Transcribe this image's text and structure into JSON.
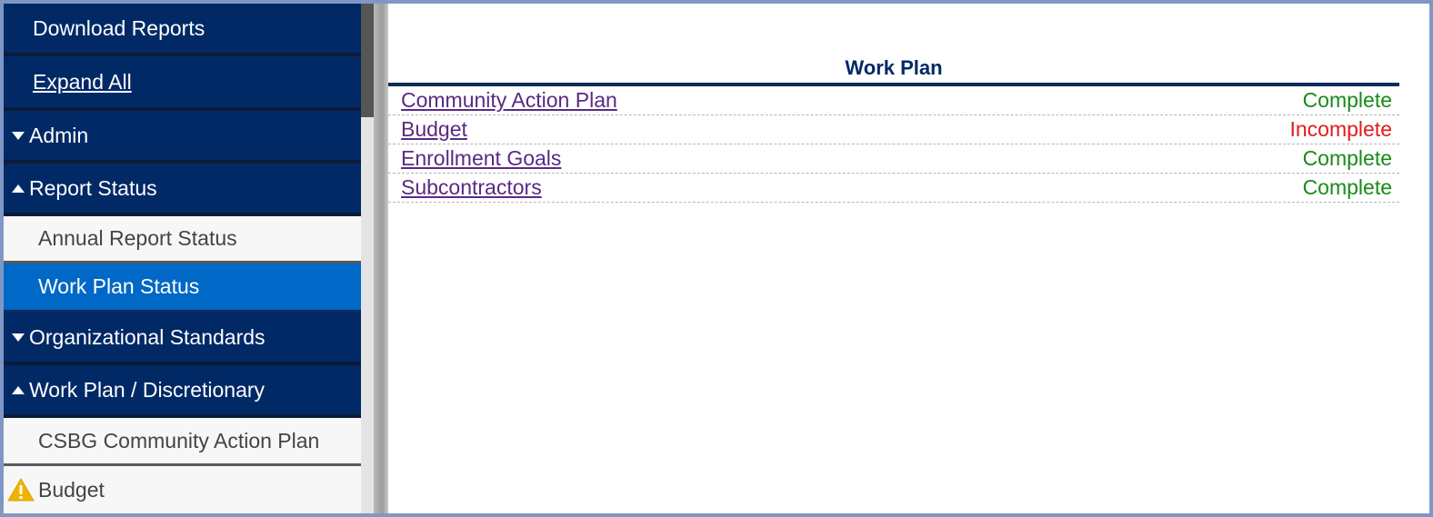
{
  "sidebar": {
    "download_reports": "Download Reports",
    "expand_all": "Expand All",
    "admin": "Admin",
    "report_status": "Report Status",
    "annual_report_status": "Annual Report Status",
    "work_plan_status": "Work Plan Status",
    "organizational_standards": "Organizational Standards",
    "work_plan_discretionary": "Work Plan / Discretionary",
    "csbg_community_action_plan": "CSBG Community Action Plan",
    "budget": "Budget"
  },
  "main": {
    "title": "Work Plan",
    "rows": [
      {
        "label": "Community Action Plan",
        "status": "Complete",
        "status_color": "#1a8a1a"
      },
      {
        "label": "Budget",
        "status": "Incomplete",
        "status_color": "#e01b1b"
      },
      {
        "label": "Enrollment Goals",
        "status": "Complete",
        "status_color": "#1a8a1a"
      },
      {
        "label": "Subcontractors",
        "status": "Complete",
        "status_color": "#1a8a1a"
      }
    ]
  },
  "colors": {
    "nav_bg": "#002966",
    "active_bg": "#0068c6",
    "link": "#5a2a82",
    "warning": "#f0b400"
  },
  "icons": {
    "collapse": "triangle-down-icon",
    "expand": "triangle-up-icon",
    "warning": "warning-icon"
  }
}
